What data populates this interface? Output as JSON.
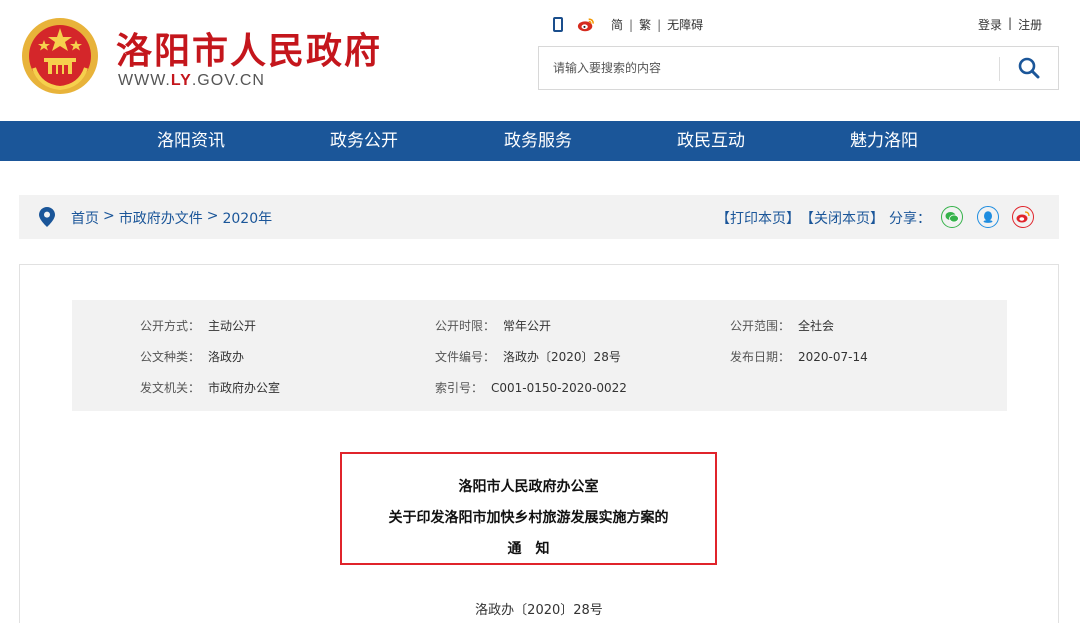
{
  "header": {
    "title": "洛阳市人民政府",
    "url_prefix": "WWW.",
    "url_highlight": "LY",
    "url_suffix": ".GOV.CN",
    "brand_color": "#c4161c",
    "lang_simplified": "简",
    "lang_traditional": "繁",
    "accessibility": "无障碍",
    "login": "登录",
    "register": "注册",
    "separator": "|",
    "search_placeholder": "请输入要搜索的内容"
  },
  "nav": {
    "color": "#1b5699",
    "items": [
      {
        "label": "洛阳资讯"
      },
      {
        "label": "政务公开"
      },
      {
        "label": "政务服务"
      },
      {
        "label": "政民互动"
      },
      {
        "label": "魅力洛阳"
      }
    ]
  },
  "breadcrumb": {
    "items": [
      "首页",
      "市政府办文件",
      "2020年"
    ],
    "separator": ">"
  },
  "tools": {
    "print": "【打印本页】",
    "close": "【关闭本页】",
    "share_label": "分享：",
    "share_icons": [
      "wechat-icon",
      "qq-icon",
      "weibo-icon"
    ]
  },
  "meta": {
    "rows": [
      [
        {
          "key": "公开方式：",
          "value": "主动公开"
        },
        {
          "key": "公开时限：",
          "value": "常年公开"
        },
        {
          "key": "公开范围：",
          "value": "全社会"
        }
      ],
      [
        {
          "key": "公文种类：",
          "value": "洛政办"
        },
        {
          "key": "文件编号：",
          "value": "洛政办〔2020〕28号"
        },
        {
          "key": "发布日期：",
          "value": "2020-07-14"
        }
      ],
      [
        {
          "key": "发文机关：",
          "value": "市政府办公室"
        },
        {
          "key": "索引号：",
          "value": "C001-0150-2020-0022"
        }
      ]
    ]
  },
  "document": {
    "title_line1": "洛阳市人民政府办公室",
    "title_line2": "关于印发洛阳市加快乡村旅游发展实施方案的",
    "title_line3": "通　知",
    "number": "洛政办〔2020〕28号",
    "highlight_color": "#e0242b"
  }
}
